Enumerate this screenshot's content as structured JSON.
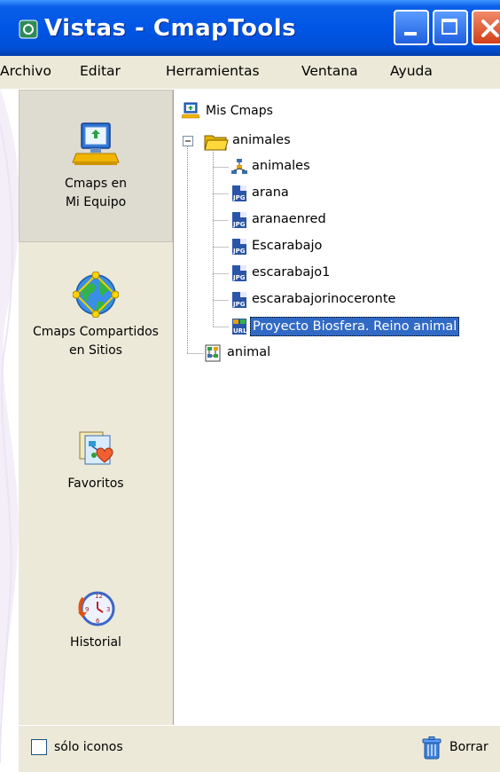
{
  "window": {
    "title": "Vistas - CmapTools",
    "controls": [
      "minimize",
      "maximize",
      "close"
    ]
  },
  "menu": [
    "Archivo",
    "Editar",
    "Herramientas",
    "Ventana",
    "Ayuda"
  ],
  "sidebar": {
    "items": [
      {
        "label_line1": "Cmaps en",
        "label_line2": "Mi Equipo",
        "icon": "computer-icon",
        "selected": true
      },
      {
        "label_line1": "Cmaps Compartidos",
        "label_line2": "en Sitios",
        "icon": "globe-network-icon",
        "selected": false
      },
      {
        "label_line1": "Favoritos",
        "label_line2": "",
        "icon": "favorites-icon",
        "selected": false
      },
      {
        "label_line1": "Historial",
        "label_line2": "",
        "icon": "history-clock-icon",
        "selected": false
      }
    ]
  },
  "tree": {
    "root_label": "Mis Cmaps",
    "folder": {
      "label": "animales",
      "expanded": true
    },
    "children": [
      {
        "label": "animales",
        "type": "cmap"
      },
      {
        "label": "arana",
        "type": "jpg"
      },
      {
        "label": "aranaenred",
        "type": "jpg"
      },
      {
        "label": "Escarabajo",
        "type": "jpg"
      },
      {
        "label": "escarabajo1",
        "type": "jpg"
      },
      {
        "label": "escarabajorinoceronte",
        "type": "jpg"
      },
      {
        "label": "Proyecto Biosfera. Reino animal",
        "type": "url",
        "selected": true
      }
    ],
    "sibling": {
      "label": "animal",
      "type": "cmap-document"
    }
  },
  "status": {
    "checkbox_label": "sólo iconos",
    "checkbox_checked": false,
    "delete_label": "Borrar"
  },
  "colors": {
    "titlebar": "#0055e5",
    "selection": "#316ac5",
    "panel_bg": "#ece9d8"
  }
}
